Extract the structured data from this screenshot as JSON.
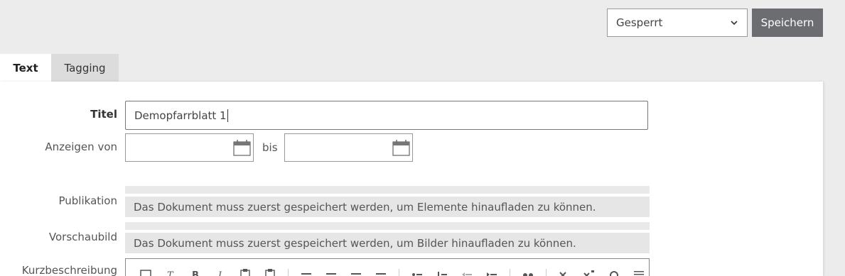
{
  "header": {
    "status_select": {
      "selected": "Gesperrt"
    },
    "save_label": "Speichern"
  },
  "tabs": [
    {
      "label": "Text",
      "active": true
    },
    {
      "label": "Tagging",
      "active": false
    }
  ],
  "form": {
    "title_label": "Titel",
    "title_value": "Demopfarrblatt 1",
    "display_label": "Anzeigen von",
    "display_from_value": "",
    "display_to_label": "bis",
    "display_to_value": "",
    "publication_label": "Publikation",
    "publication_info": "Das Dokument muss zuerst gespeichert werden, um Elemente hinaufladen zu können.",
    "preview_label": "Vorschaubild",
    "preview_info": "Das Dokument muss zuerst gespeichert werden, um Bilder hinaufladen zu können.",
    "summary_label": "Kurzbeschreibung"
  },
  "editor_toolbar": [
    "save-icon",
    "clear-format-icon",
    "bold-icon",
    "italic-icon",
    "paste-icon",
    "paste-text-icon",
    "align-left-icon",
    "align-center-icon",
    "align-right-icon",
    "align-justify-icon",
    "bullet-list-icon",
    "numbered-list-icon",
    "outdent-icon",
    "indent-icon",
    "quote-icon",
    "subscript-icon",
    "superscript-icon",
    "special-char-icon",
    "horizontal-rule-icon"
  ],
  "colors": {
    "save_button_bg": "#6b6d70",
    "page_bg": "#ececec",
    "panel_bg": "#ffffff"
  }
}
